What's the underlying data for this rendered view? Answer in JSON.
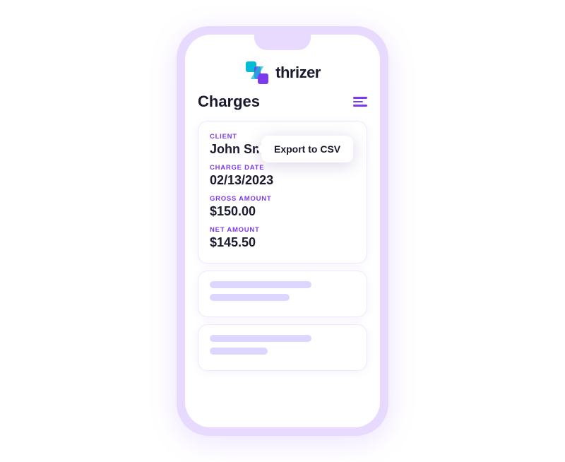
{
  "app": {
    "name": "thrizer"
  },
  "page": {
    "title": "Charges",
    "menu_icon_label": "menu"
  },
  "tooltip": {
    "label": "Export to CSV"
  },
  "charge_card": {
    "client_label": "CLIENT",
    "client_value": "John Smith",
    "charge_date_label": "CHARGE DATE",
    "charge_date_value": "02/13/2023",
    "gross_amount_label": "GROSS AMOUNT",
    "gross_amount_value": "$150.00",
    "net_amount_label": "NET AMOUNT",
    "net_amount_value": "$145.50"
  },
  "colors": {
    "accent": "#7c3aed",
    "teal": "#00bcd4",
    "dark": "#1a1a2e",
    "light_purple": "#e8d9ff"
  }
}
